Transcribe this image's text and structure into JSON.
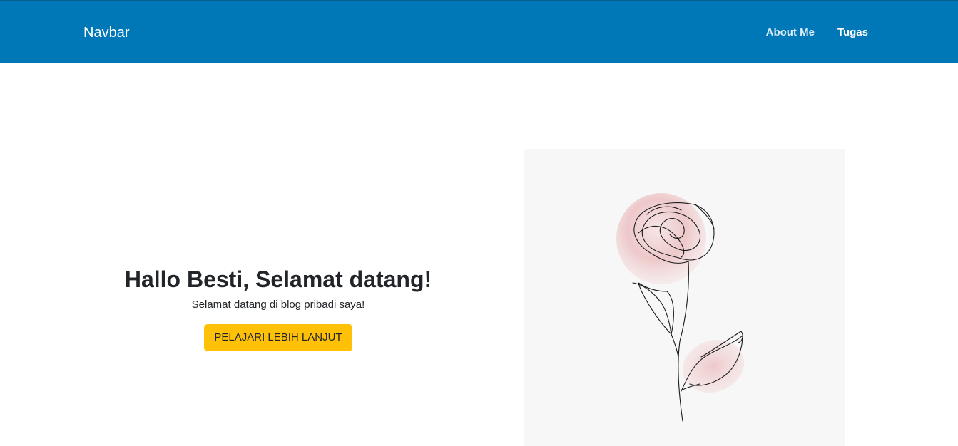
{
  "navbar": {
    "brand": "Navbar",
    "links": [
      {
        "label": "About Me"
      },
      {
        "label": "Tugas"
      }
    ],
    "background_color": "#0077b6"
  },
  "hero": {
    "title": "Hallo Besti, Selamat datang!",
    "subtitle": "Selamat datang di blog pribadi saya!",
    "button_label": "PELAJARI LEBIH LANJUT",
    "button_color": "#ffc107",
    "illustration": "rose-line-art"
  }
}
